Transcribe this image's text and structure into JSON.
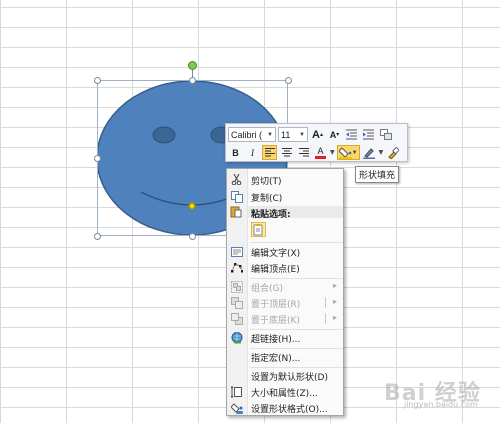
{
  "mini_toolbar": {
    "font_name": "Calibri (",
    "font_size": "11",
    "grow_font": "A",
    "shrink_font": "A",
    "bold": "B",
    "italic": "I",
    "font_color_letter": "A"
  },
  "tooltip": "形状填充",
  "context_menu": {
    "cut": "剪切(T)",
    "copy": "复制(C)",
    "paste_options": "粘贴选项:",
    "edit_text": "编辑文字(X)",
    "edit_points": "编辑顶点(E)",
    "group": "组合(G)",
    "bring_to_front": "置于顶层(R)",
    "send_to_back": "置于底层(K)",
    "hyperlink": "超链接(H)...",
    "assign_macro": "指定宏(N)...",
    "set_default": "设置为默认形状(D)",
    "size_properties": "大小和属性(Z)...",
    "format_shape": "设置形状格式(O)..."
  },
  "watermark": "Bai 经验",
  "watermark_sub": "jingyan.baidu.com",
  "colors": {
    "shape_fill": "#4f81bd",
    "shape_outline": "#385d8a",
    "accent_highlight": "#fbd66a",
    "font_color_bar": "#e02020",
    "fill_color_bar": "#f2c400"
  }
}
